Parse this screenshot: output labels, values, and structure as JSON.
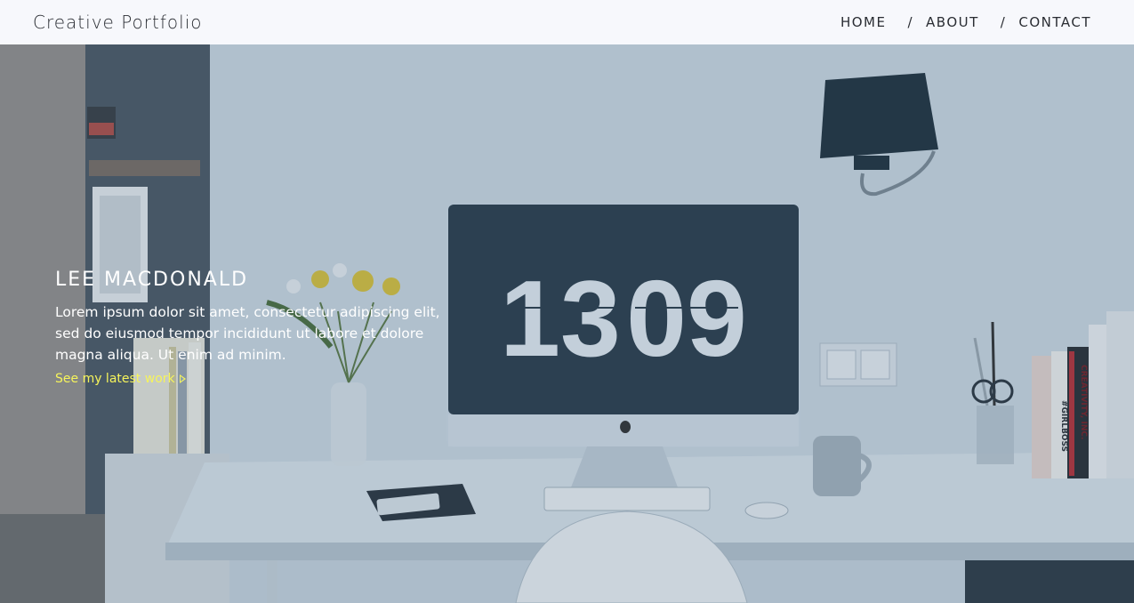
{
  "header": {
    "brand": "Creative Portfolio",
    "nav": [
      {
        "label": "HOME"
      },
      {
        "label": "ABOUT"
      },
      {
        "label": "CONTACT"
      }
    ],
    "separator": "/"
  },
  "hero": {
    "name": "LEE MACDONALD",
    "lead": "Lorem ipsum dolor sit amet, consectetur adipiscing elit, sed do eiusmod tempor incididunt ut labore et dolore magna aliqua. Ut enim ad minim.",
    "cta": "See my latest work",
    "clock_hours": "13",
    "clock_minutes": "09",
    "book_spines": [
      "CREATIVITY, INC.",
      "#GIRLBOSS"
    ]
  },
  "colors": {
    "header_bg": "#f7f8fc",
    "cta": "#f6f45b",
    "screen": "#2d3e4c",
    "wall": "#c6d4df"
  }
}
